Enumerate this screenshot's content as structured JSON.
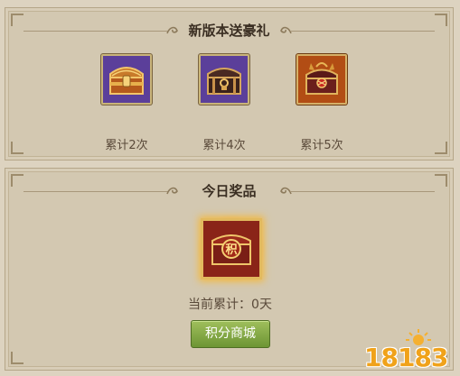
{
  "top_section": {
    "title": "新版本送豪礼",
    "rewards": [
      {
        "label": "累计2次",
        "icon": "treasure-chest-gold-icon",
        "frame_color": "#5b3f9a"
      },
      {
        "label": "累计4次",
        "icon": "treasure-chest-dark-icon",
        "frame_color": "#5b3f9a"
      },
      {
        "label": "累计5次",
        "icon": "treasure-chest-dragon-icon",
        "frame_color": "#b24d14"
      }
    ]
  },
  "bottom_section": {
    "title": "今日奖品",
    "prize_icon": "points-chest-icon",
    "prize_glyph": "积",
    "current_label": "当前累计：0天",
    "shop_button": "积分商城"
  },
  "watermark": {
    "text": "18183"
  },
  "colors": {
    "background": "#ddd3c0",
    "panel": "#d3c8b1",
    "button_green": "#7ea342",
    "title_text": "#3a2e22"
  }
}
